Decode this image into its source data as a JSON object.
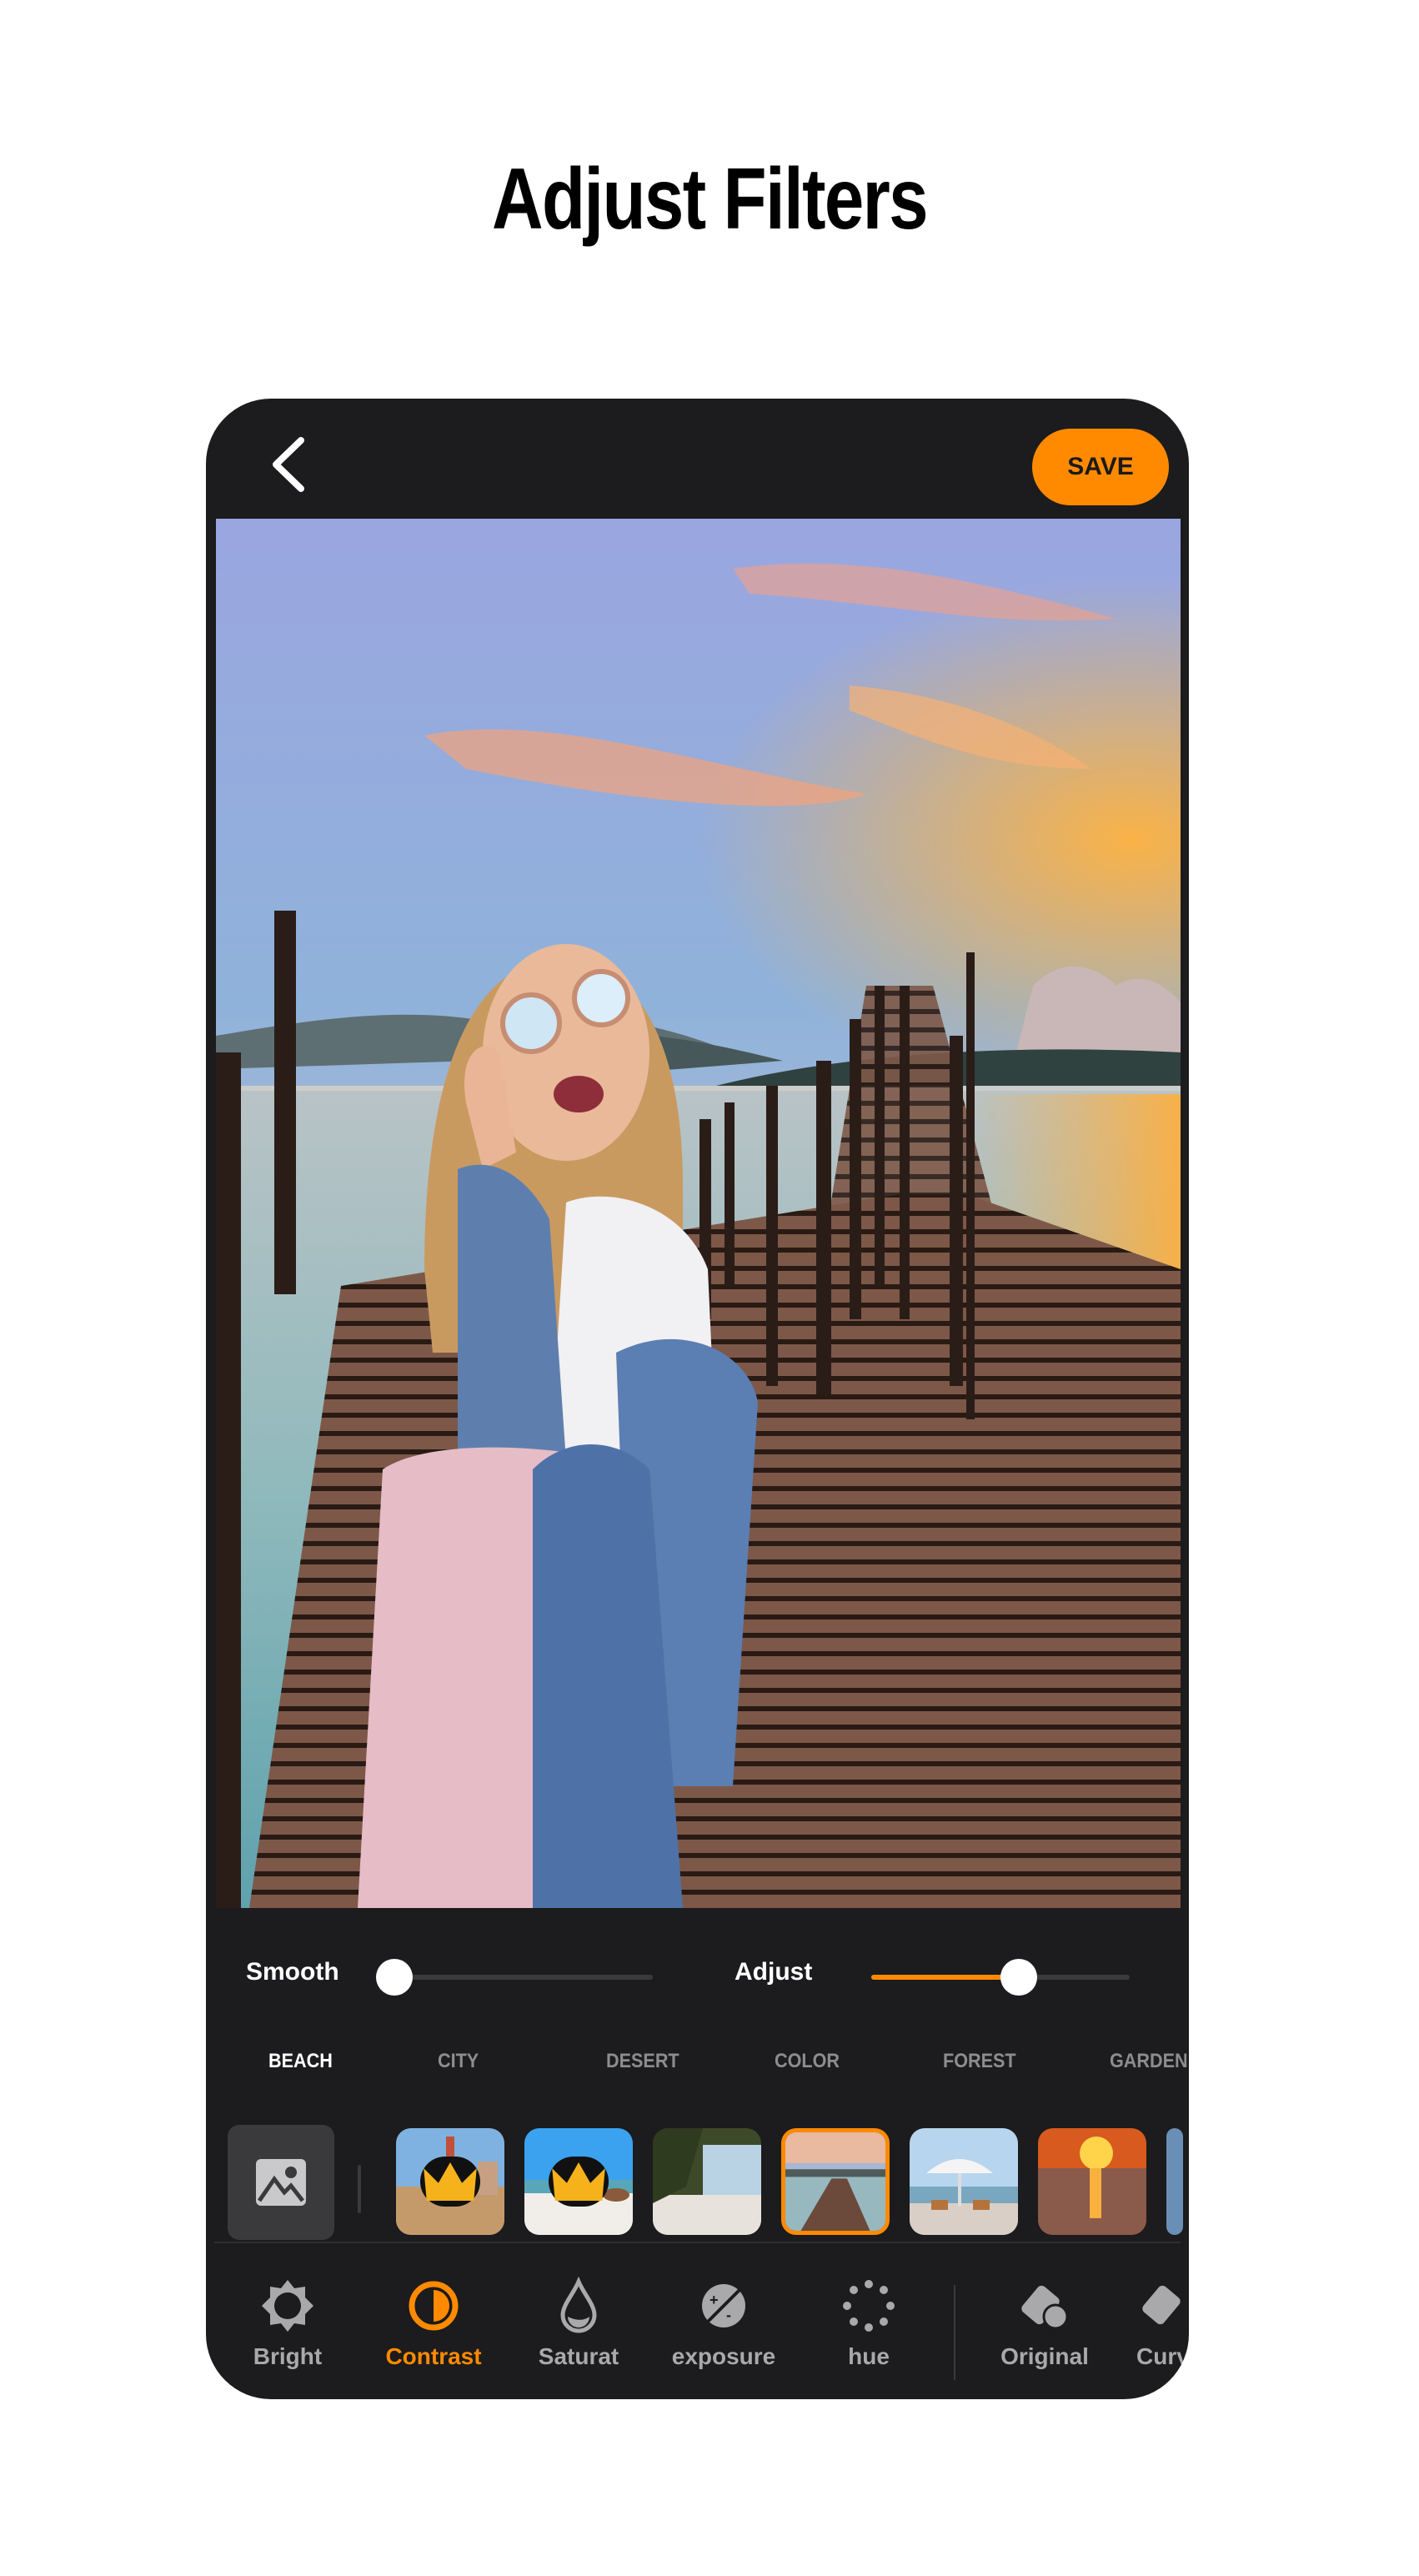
{
  "headline": "Adjust Filters",
  "topbar": {
    "back_icon": "chevron-left-icon",
    "save_label": "SAVE"
  },
  "colors": {
    "accent": "#ff8a00",
    "panel_bg": "#1c1b1d",
    "inactive_text": "#a9a9ac",
    "page_bg": "#ffffff"
  },
  "photo": {
    "description": "Woman in mirrored sunglasses and denim jacket laughing on a wooden pier over a lake at sunset"
  },
  "sliders": [
    {
      "label": "Smooth",
      "value": 0.0
    },
    {
      "label": "Adjust",
      "value": 0.57
    }
  ],
  "categories": {
    "items": [
      "BEACH",
      "CITY",
      "DESERT",
      "COLOR",
      "FOREST",
      "GARDEN"
    ],
    "active": "BEACH"
  },
  "thumbnails": {
    "gallery_icon": "image-icon",
    "items": [
      {
        "name": "golden-gate",
        "premium": true,
        "selected": false
      },
      {
        "name": "beach-boat",
        "premium": true,
        "selected": false
      },
      {
        "name": "tropical-shore",
        "premium": false,
        "selected": false
      },
      {
        "name": "pier-sunset",
        "premium": false,
        "selected": true
      },
      {
        "name": "umbrella-chairs",
        "premium": false,
        "selected": false
      },
      {
        "name": "ocean-sunset",
        "premium": false,
        "selected": false
      }
    ],
    "premium_icon": "crown-icon"
  },
  "tools": {
    "items": [
      {
        "label": "Bright",
        "icon": "brightness-icon",
        "active": false
      },
      {
        "label": "Contrast",
        "icon": "contrast-icon",
        "active": true
      },
      {
        "label": "Saturat",
        "icon": "saturation-drop-icon",
        "active": false
      },
      {
        "label": "exposure",
        "icon": "exposure-icon",
        "active": false
      },
      {
        "label": "hue",
        "icon": "hue-dots-icon",
        "active": false
      },
      {
        "label": "Original",
        "icon": "eraser-icon",
        "active": false
      },
      {
        "label": "Curv",
        "icon": "eraser-icon",
        "active": false
      }
    ]
  }
}
